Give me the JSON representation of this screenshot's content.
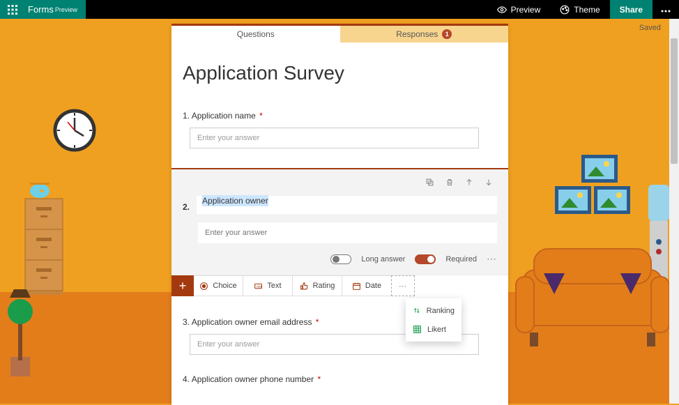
{
  "top": {
    "brand": "Forms",
    "brand_sup": "Preview",
    "preview": "Preview",
    "theme": "Theme",
    "share": "Share"
  },
  "status": {
    "saved": "Saved"
  },
  "tabs": {
    "questions": "Questions",
    "responses": "Responses",
    "response_count": "1"
  },
  "form": {
    "title": "Application Survey",
    "q1": {
      "num": "1.",
      "label": "Application name",
      "placeholder": "Enter your answer"
    },
    "q2": {
      "num": "2.",
      "title": "Application owner",
      "placeholder": "Enter your answer",
      "long_answer": "Long answer",
      "required": "Required"
    },
    "q3": {
      "num": "3.",
      "label": "Application owner email address",
      "placeholder": "Enter your answer"
    },
    "q4": {
      "num": "4.",
      "label": "Application owner phone number"
    }
  },
  "add": {
    "choice": "Choice",
    "text": "Text",
    "rating": "Rating",
    "date": "Date",
    "ranking": "Ranking",
    "likert": "Likert"
  }
}
